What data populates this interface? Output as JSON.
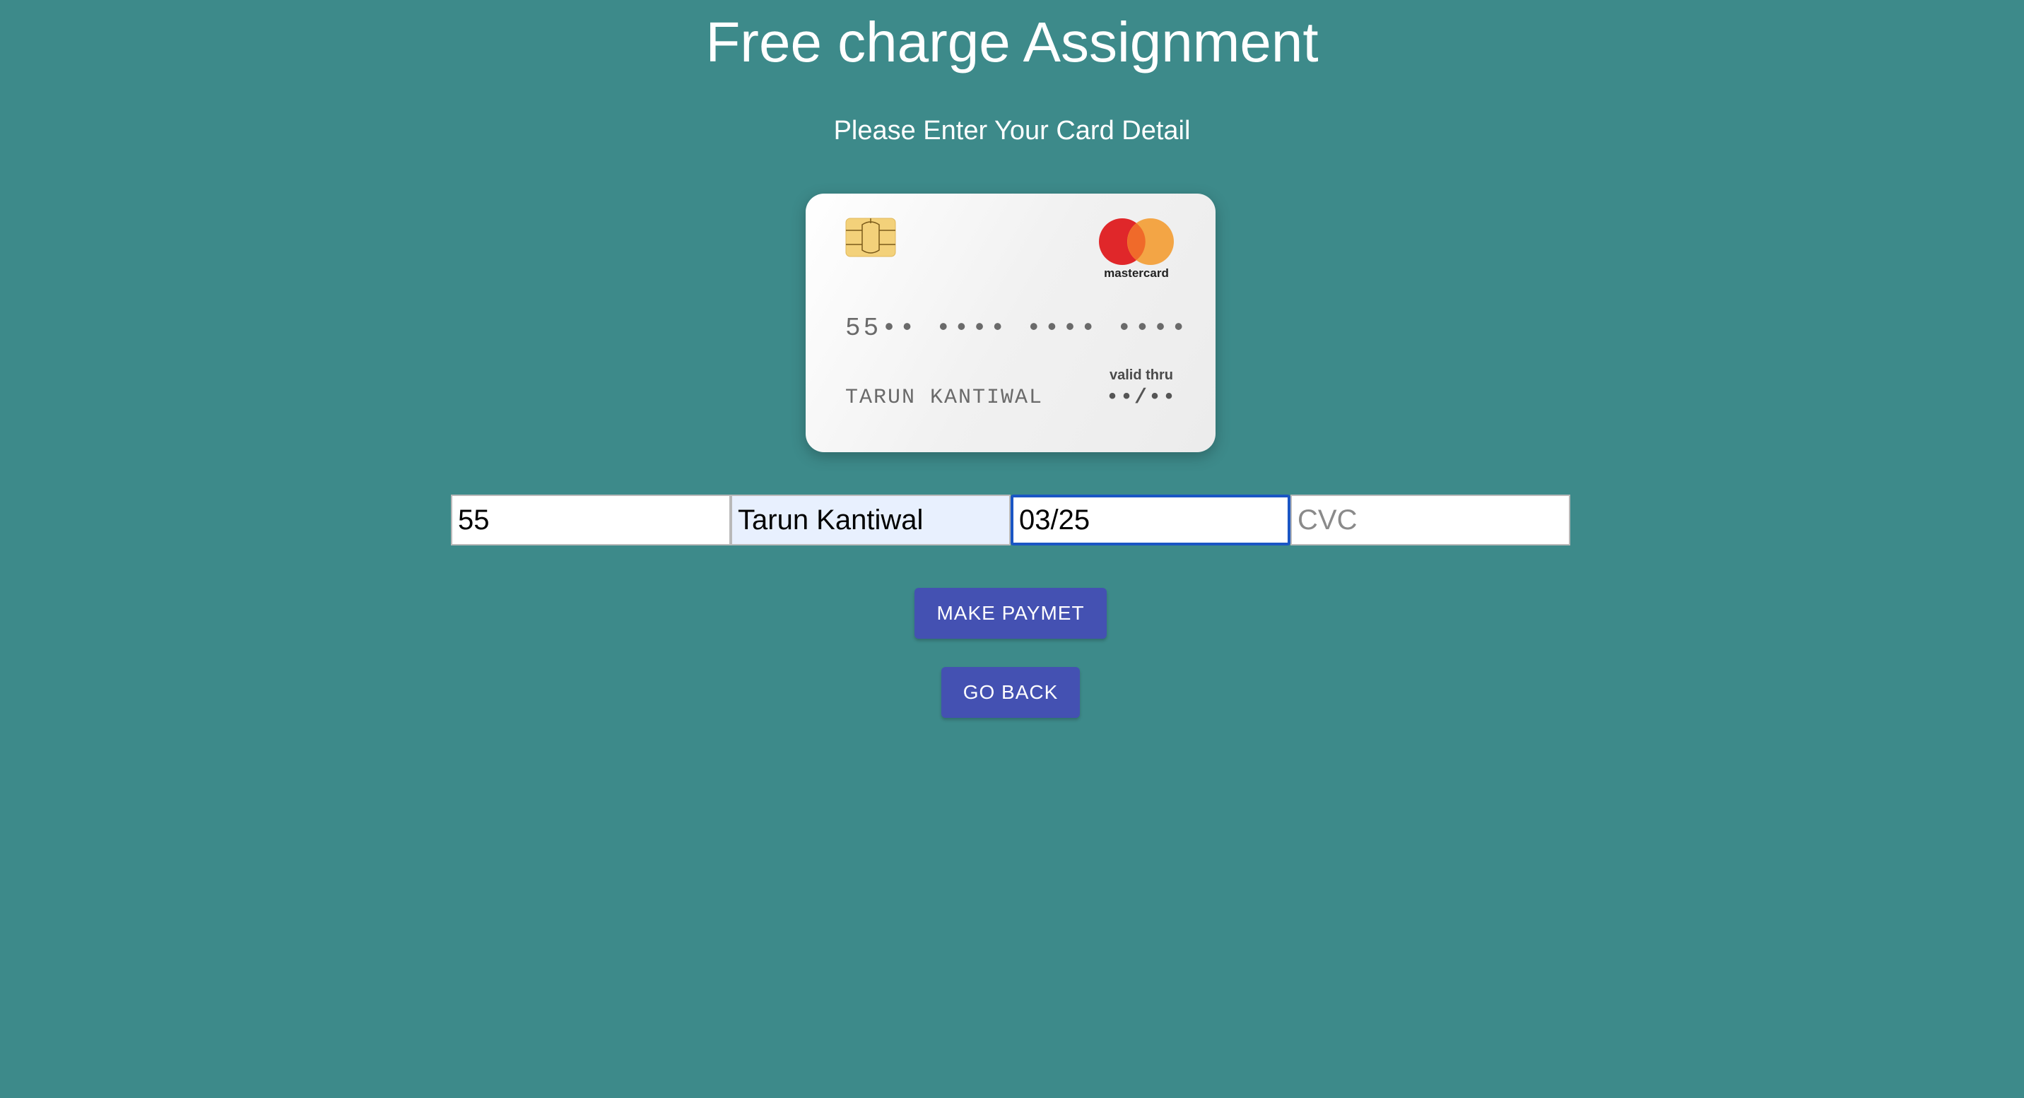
{
  "header": {
    "title": "Free charge Assignment",
    "subtitle": "Please Enter Your Card Detail"
  },
  "card_preview": {
    "number": "55•• •••• •••• ••••",
    "holder_name": "TARUN KANTIWAL",
    "valid_thru_label": "valid thru",
    "expiry": "••/••",
    "brand": "mastercard",
    "brand_colors": {
      "red": "#e0272a",
      "orange": "#f2a03b"
    }
  },
  "form": {
    "card_number": {
      "value": "55",
      "placeholder": ""
    },
    "name": {
      "value": "Tarun Kantiwal",
      "placeholder": ""
    },
    "expiry": {
      "value": "03/25",
      "placeholder": ""
    },
    "cvc": {
      "value": "",
      "placeholder": "CVC"
    }
  },
  "buttons": {
    "pay_label": "MAKE PAYMET",
    "back_label": "GO BACK"
  },
  "colors": {
    "background": "#3d8a8a",
    "button": "#4451b2",
    "focus_border": "#1a56c4"
  }
}
